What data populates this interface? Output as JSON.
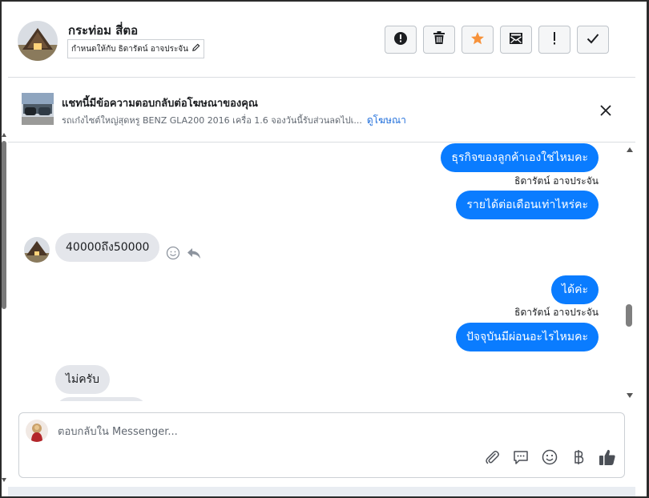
{
  "header": {
    "contact_name": "กระท่อม สี่ตอ",
    "assign_label": "กำหนดให้กับ ธิดารัตน์ อาจประจัน",
    "actions": [
      {
        "name": "spam-button",
        "icon": "alert-circle-icon"
      },
      {
        "name": "delete-button",
        "icon": "trash-icon"
      },
      {
        "name": "star-button",
        "icon": "star-icon"
      },
      {
        "name": "mark-unread-button",
        "icon": "envelope-icon"
      },
      {
        "name": "follow-up-button",
        "icon": "exclamation-icon"
      },
      {
        "name": "mark-done-button",
        "icon": "checkmark-icon"
      }
    ]
  },
  "ad_banner": {
    "title": "แชทนี้มีข้อความตอบกลับต่อโฆษณาของคุณ",
    "description": "รถเก๋งไซต์ใหญ่สุดหรู BENZ GLA200 2016 เครื่อ 1.6 จองวันนี้รับส่วนลดไปเ...",
    "link": "ดูโฆษณา"
  },
  "messages": [
    {
      "direction": "out",
      "text": "ธุรกิจของลูกค้าเองใช่ไหมคะ"
    },
    {
      "direction": "out",
      "sender": "ธิดารัตน์ อาจประจัน",
      "text": "รายได้ต่อเดือนเท่าไหร่คะ"
    },
    {
      "direction": "in",
      "text": "40000ถึง50000"
    },
    {
      "direction": "out",
      "text": "ได้ค่ะ"
    },
    {
      "direction": "out",
      "sender": "ธิดารัตน์ อาจประจัน",
      "text": "ปัจจุบันมีผ่อนอะไรไหมคะ"
    },
    {
      "direction": "in",
      "text": "ไม่ครับ"
    }
  ],
  "composer": {
    "placeholder": "ตอบกลับใน Messenger..."
  },
  "colors": {
    "outgoing_bubble": "#0a7cff",
    "incoming_bubble": "#e4e6eb",
    "star": "#f7923a",
    "link": "#216fdb"
  }
}
